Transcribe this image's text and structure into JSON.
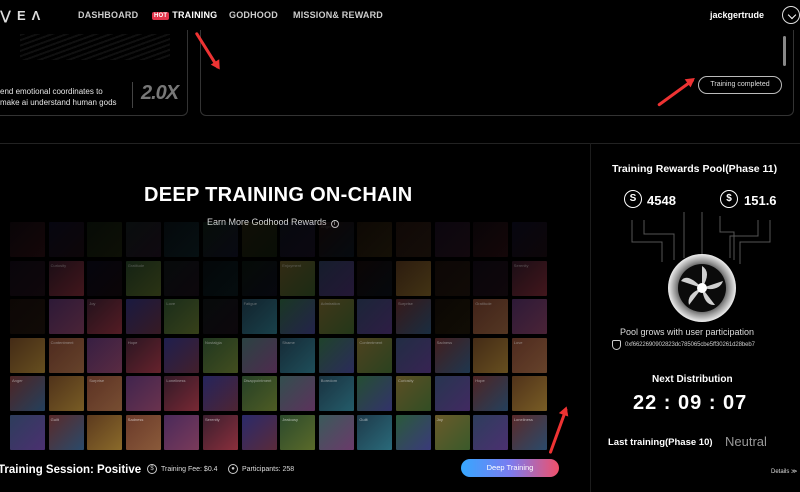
{
  "nav": {
    "logo": "⋁EΛ",
    "items": [
      "DASHBOARD",
      "TRAINING",
      "GODHOOD",
      "MISSION& REWARD"
    ],
    "hot_badge": "HOT",
    "user": "jackgertrude"
  },
  "top": {
    "card_text_1": "end emotional coordinates to",
    "card_text_2": "make ai understand human gods",
    "multiplier": "2.0X",
    "status": "Training completed"
  },
  "main": {
    "title": "DEEP TRAINING ON-CHAIN",
    "subtitle": "Earn More Godhood Rewards",
    "tile_labels": [
      "Anger",
      "Guilt",
      "Contentment",
      "Curiosity",
      "Surprise",
      "Joy",
      "Sadness",
      "Hope",
      "Gratitude",
      "Loneliness",
      "Love",
      "Serenity",
      "Nostalgia",
      "Disappointment",
      "Fatigue",
      "Jealousy",
      "Shame",
      "Enjoyment",
      "Boredom",
      "Admiration"
    ]
  },
  "session": {
    "label": "Training Session: Positive",
    "fee": "Training Fee: $0.4",
    "participants": "Participants: 258",
    "button": "Deep Training"
  },
  "pool": {
    "title": "Training Rewards Pool(Phase 11)",
    "value_1": "4548",
    "value_2": "151.6",
    "caption": "Pool grows with user participation",
    "address": "0xf6622690902823dc785065cbe5ff30261d28beb7",
    "next_label": "Next Distribution",
    "countdown": "22 : 09 : 07",
    "last_label": "Last training(Phase 10)",
    "last_result": "Neutral",
    "details": "Details ≫"
  },
  "colors": {
    "accent_red": "#e33333",
    "button_gradient_start": "#36a7ff",
    "button_gradient_end": "#f0506a"
  }
}
